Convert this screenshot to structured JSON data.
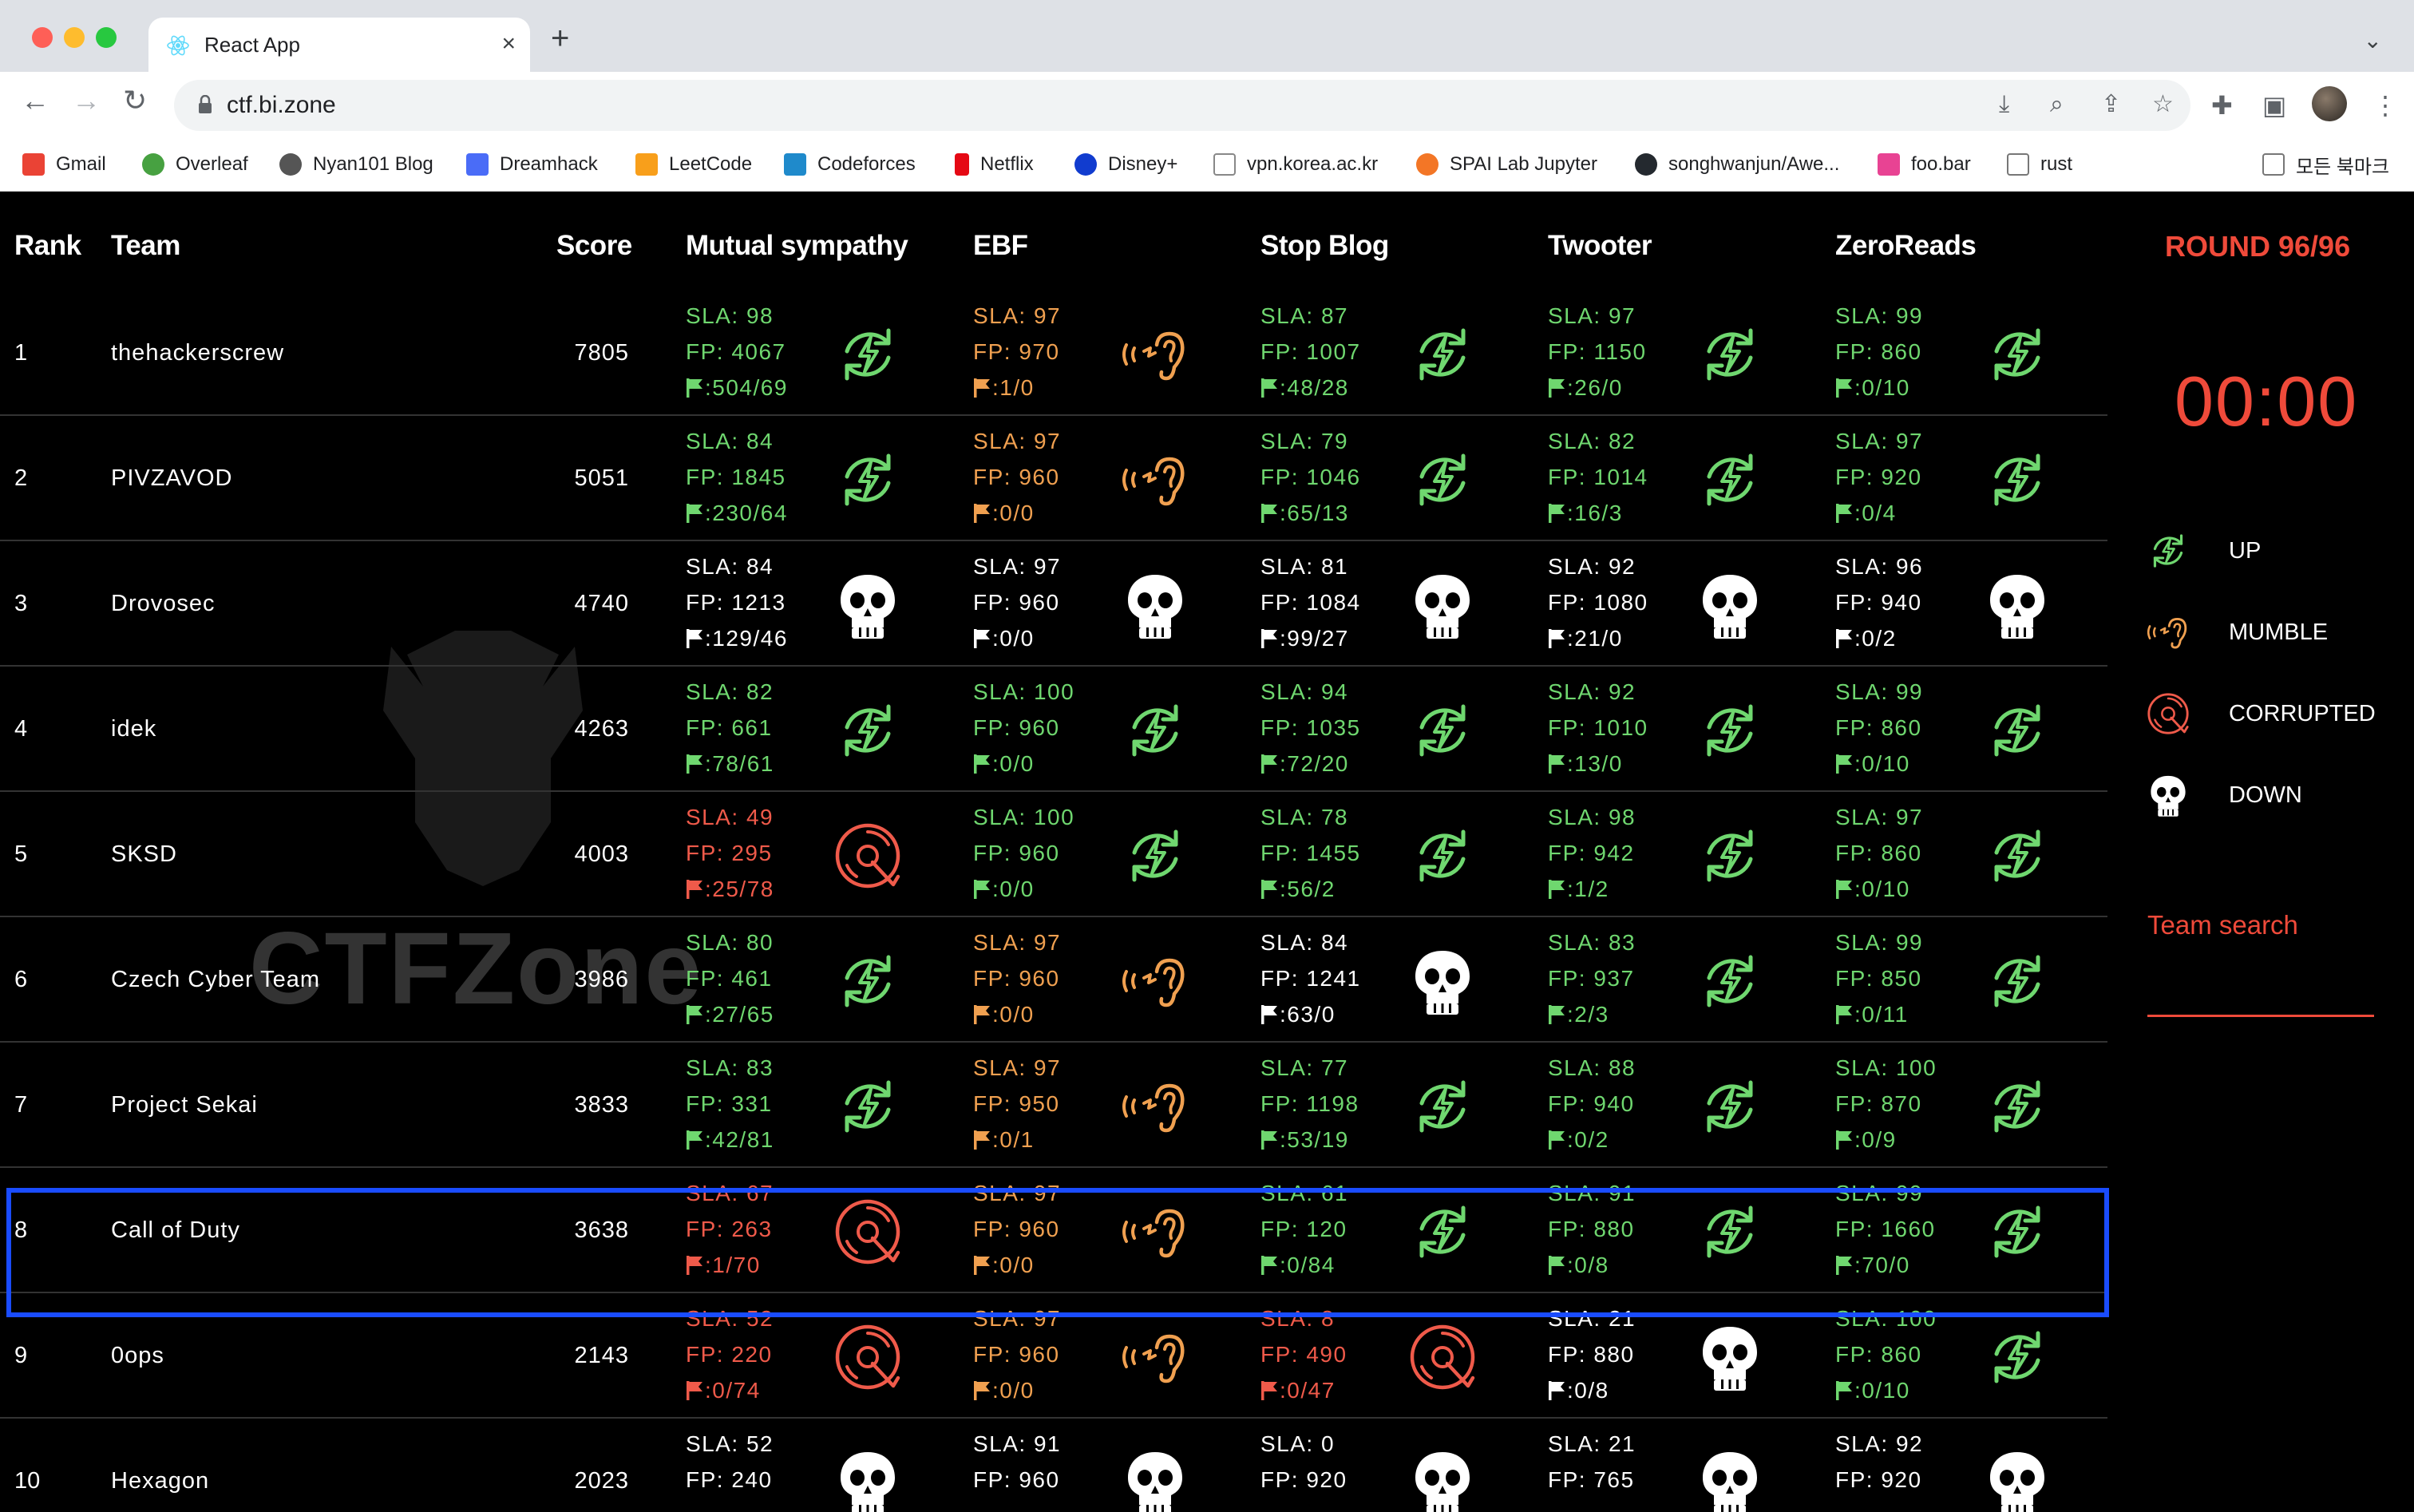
{
  "browser": {
    "tab_title": "React App",
    "url": "ctf.bi.zone",
    "bookmarks": [
      {
        "label": "Gmail",
        "color": "#ea4335"
      },
      {
        "label": "Overleaf",
        "color": "#47a141"
      },
      {
        "label": "Nyan101 Blog",
        "color": "#555555"
      },
      {
        "label": "Dreamhack",
        "color": "#4a6cf7"
      },
      {
        "label": "LeetCode",
        "color": "#f89f1b"
      },
      {
        "label": "Codeforces",
        "color": "#1f8acb"
      },
      {
        "label": "Netflix",
        "color": "#e50914"
      },
      {
        "label": "Disney+",
        "color": "#113ccf"
      },
      {
        "label": "vpn.korea.ac.kr",
        "color": "#888888"
      },
      {
        "label": "SPAI Lab Jupyter",
        "color": "#f37626"
      },
      {
        "label": "songhwanjun/Awe...",
        "color": "#24292f"
      },
      {
        "label": "foo.bar",
        "color": "#e84393"
      },
      {
        "label": "rust",
        "color": "#777777"
      }
    ],
    "other_bookmarks": "모든 북마크"
  },
  "board": {
    "headers": {
      "rank": "Rank",
      "team": "Team",
      "score": "Score"
    },
    "services": [
      "Mutual sympathy",
      "EBF",
      "Stop Blog",
      "Twooter",
      "ZeroReads"
    ],
    "watermark_text": "CTFZone",
    "colors": {
      "up": "#6fd76f",
      "mumble": "#f0a050",
      "corrupted": "#ef5a4a",
      "down": "#ffffff",
      "highlight": "#1a4cff"
    },
    "rows": [
      {
        "rank": "1",
        "team": "thehackerscrew",
        "score": "7805",
        "svc": [
          {
            "state": "up",
            "sla": "SLA: 98",
            "fp": "FP: 4067",
            "flags": ":504/69"
          },
          {
            "state": "mumble",
            "sla": "SLA: 97",
            "fp": "FP: 970",
            "flags": ":1/0"
          },
          {
            "state": "up",
            "sla": "SLA: 87",
            "fp": "FP: 1007",
            "flags": ":48/28"
          },
          {
            "state": "up",
            "sla": "SLA: 97",
            "fp": "FP: 1150",
            "flags": ":26/0"
          },
          {
            "state": "up",
            "sla": "SLA: 99",
            "fp": "FP: 860",
            "flags": ":0/10"
          }
        ]
      },
      {
        "rank": "2",
        "team": "PIVZAVOD",
        "score": "5051",
        "svc": [
          {
            "state": "up",
            "sla": "SLA: 84",
            "fp": "FP: 1845",
            "flags": ":230/64"
          },
          {
            "state": "mumble",
            "sla": "SLA: 97",
            "fp": "FP: 960",
            "flags": ":0/0"
          },
          {
            "state": "up",
            "sla": "SLA: 79",
            "fp": "FP: 1046",
            "flags": ":65/13"
          },
          {
            "state": "up",
            "sla": "SLA: 82",
            "fp": "FP: 1014",
            "flags": ":16/3"
          },
          {
            "state": "up",
            "sla": "SLA: 97",
            "fp": "FP: 920",
            "flags": ":0/4"
          }
        ]
      },
      {
        "rank": "3",
        "team": "Drovosec",
        "score": "4740",
        "svc": [
          {
            "state": "down",
            "sla": "SLA: 84",
            "fp": "FP: 1213",
            "flags": ":129/46"
          },
          {
            "state": "down",
            "sla": "SLA: 97",
            "fp": "FP: 960",
            "flags": ":0/0"
          },
          {
            "state": "down",
            "sla": "SLA: 81",
            "fp": "FP: 1084",
            "flags": ":99/27"
          },
          {
            "state": "down",
            "sla": "SLA: 92",
            "fp": "FP: 1080",
            "flags": ":21/0"
          },
          {
            "state": "down",
            "sla": "SLA: 96",
            "fp": "FP: 940",
            "flags": ":0/2"
          }
        ]
      },
      {
        "rank": "4",
        "team": "idek",
        "score": "4263",
        "svc": [
          {
            "state": "up",
            "sla": "SLA: 82",
            "fp": "FP: 661",
            "flags": ":78/61"
          },
          {
            "state": "up",
            "sla": "SLA: 100",
            "fp": "FP: 960",
            "flags": ":0/0"
          },
          {
            "state": "up",
            "sla": "SLA: 94",
            "fp": "FP: 1035",
            "flags": ":72/20"
          },
          {
            "state": "up",
            "sla": "SLA: 92",
            "fp": "FP: 1010",
            "flags": ":13/0"
          },
          {
            "state": "up",
            "sla": "SLA: 99",
            "fp": "FP: 860",
            "flags": ":0/10"
          }
        ]
      },
      {
        "rank": "5",
        "team": "SKSD",
        "score": "4003",
        "svc": [
          {
            "state": "corrupted",
            "sla": "SLA: 49",
            "fp": "FP: 295",
            "flags": ":25/78"
          },
          {
            "state": "up",
            "sla": "SLA: 100",
            "fp": "FP: 960",
            "flags": ":0/0"
          },
          {
            "state": "up",
            "sla": "SLA: 78",
            "fp": "FP: 1455",
            "flags": ":56/2"
          },
          {
            "state": "up",
            "sla": "SLA: 98",
            "fp": "FP: 942",
            "flags": ":1/2"
          },
          {
            "state": "up",
            "sla": "SLA: 97",
            "fp": "FP: 860",
            "flags": ":0/10"
          }
        ]
      },
      {
        "rank": "6",
        "team": "Czech Cyber Team",
        "score": "3986",
        "svc": [
          {
            "state": "up",
            "sla": "SLA: 80",
            "fp": "FP: 461",
            "flags": ":27/65"
          },
          {
            "state": "mumble",
            "sla": "SLA: 97",
            "fp": "FP: 960",
            "flags": ":0/0"
          },
          {
            "state": "down",
            "sla": "SLA: 84",
            "fp": "FP: 1241",
            "flags": ":63/0"
          },
          {
            "state": "up",
            "sla": "SLA: 83",
            "fp": "FP: 937",
            "flags": ":2/3"
          },
          {
            "state": "up",
            "sla": "SLA: 99",
            "fp": "FP: 850",
            "flags": ":0/11"
          }
        ]
      },
      {
        "rank": "7",
        "team": "Project Sekai",
        "score": "3833",
        "svc": [
          {
            "state": "up",
            "sla": "SLA: 83",
            "fp": "FP: 331",
            "flags": ":42/81"
          },
          {
            "state": "mumble",
            "sla": "SLA: 97",
            "fp": "FP: 950",
            "flags": ":0/1"
          },
          {
            "state": "up",
            "sla": "SLA: 77",
            "fp": "FP: 1198",
            "flags": ":53/19"
          },
          {
            "state": "up",
            "sla": "SLA: 88",
            "fp": "FP: 940",
            "flags": ":0/2"
          },
          {
            "state": "up",
            "sla": "SLA: 100",
            "fp": "FP: 870",
            "flags": ":0/9"
          }
        ]
      },
      {
        "rank": "8",
        "team": "Call of Duty",
        "score": "3638",
        "svc": [
          {
            "state": "corrupted",
            "sla": "SLA: 67",
            "fp": "FP: 263",
            "flags": ":1/70"
          },
          {
            "state": "mumble",
            "sla": "SLA: 97",
            "fp": "FP: 960",
            "flags": ":0/0"
          },
          {
            "state": "up",
            "sla": "SLA: 61",
            "fp": "FP: 120",
            "flags": ":0/84"
          },
          {
            "state": "up",
            "sla": "SLA: 91",
            "fp": "FP: 880",
            "flags": ":0/8"
          },
          {
            "state": "up",
            "sla": "SLA: 99",
            "fp": "FP: 1660",
            "flags": ":70/0"
          }
        ]
      },
      {
        "rank": "9",
        "team": "0ops",
        "score": "2143",
        "svc": [
          {
            "state": "corrupted",
            "sla": "SLA: 52",
            "fp": "FP: 220",
            "flags": ":0/74"
          },
          {
            "state": "mumble",
            "sla": "SLA: 97",
            "fp": "FP: 960",
            "flags": ":0/0"
          },
          {
            "state": "corrupted",
            "sla": "SLA: 8",
            "fp": "FP: 490",
            "flags": ":0/47"
          },
          {
            "state": "down",
            "sla": "SLA: 21",
            "fp": "FP: 880",
            "flags": ":0/8"
          },
          {
            "state": "up",
            "sla": "SLA: 100",
            "fp": "FP: 860",
            "flags": ":0/10"
          }
        ]
      },
      {
        "rank": "10",
        "team": "Hexagon",
        "score": "2023",
        "svc": [
          {
            "state": "down",
            "sla": "SLA: 52",
            "fp": "FP: 240",
            "flags": ""
          },
          {
            "state": "down",
            "sla": "SLA: 91",
            "fp": "FP: 960",
            "flags": ""
          },
          {
            "state": "down",
            "sla": "SLA: 0",
            "fp": "FP: 920",
            "flags": ""
          },
          {
            "state": "down",
            "sla": "SLA: 21",
            "fp": "FP: 765",
            "flags": ""
          },
          {
            "state": "down",
            "sla": "SLA: 92",
            "fp": "FP: 920",
            "flags": ""
          }
        ]
      }
    ]
  },
  "panel": {
    "round": "ROUND 96/96",
    "timer": "00:00",
    "legend": [
      {
        "state": "up",
        "label": "UP"
      },
      {
        "state": "mumble",
        "label": "MUMBLE"
      },
      {
        "state": "corrupted",
        "label": "CORRUPTED"
      },
      {
        "state": "down",
        "label": "DOWN"
      }
    ],
    "search_label": "Team search",
    "search_value": ""
  }
}
